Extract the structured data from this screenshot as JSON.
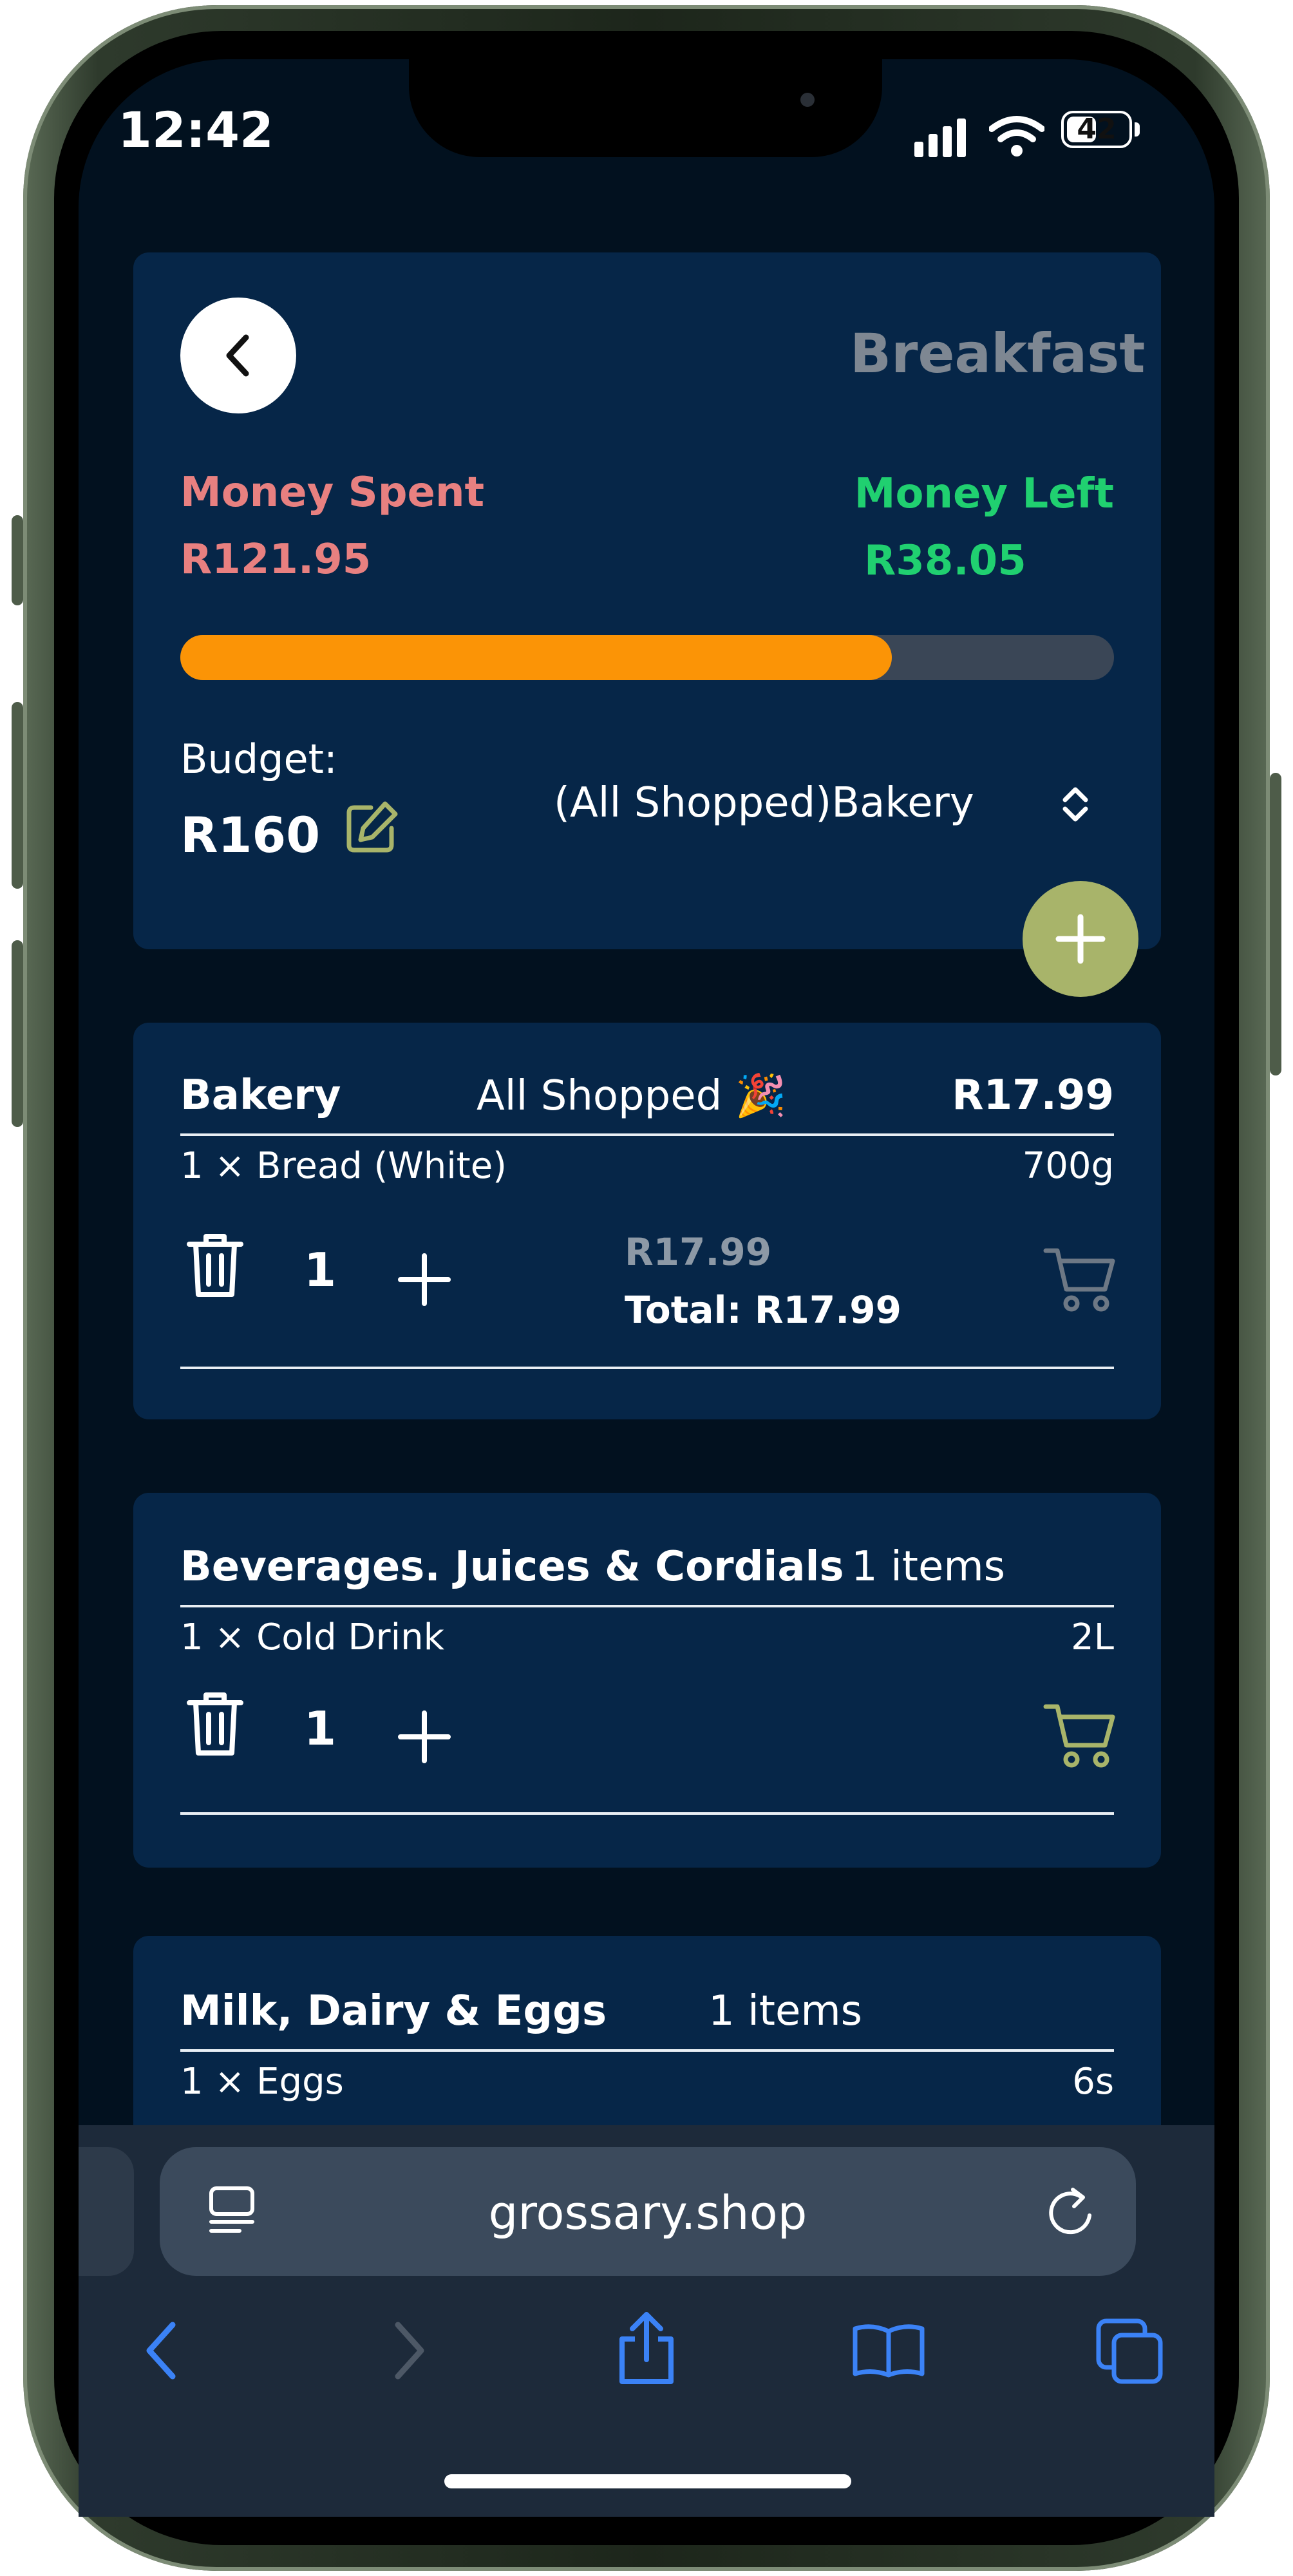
{
  "status": {
    "time": "12:42",
    "battery": "42"
  },
  "header": {
    "title": "Breakfast",
    "money_spent_label": "Money Spent",
    "money_spent_value": "R121.95",
    "money_left_label": "Money Left",
    "money_left_value": "R38.05",
    "spent_fraction": 0.7622,
    "budget_label": "Budget:",
    "budget_value": "R160",
    "category_select_value": "(All Shopped)Bakery"
  },
  "categories": [
    {
      "name": "Bakery",
      "status": "All Shopped 🎉",
      "total": "R17.99",
      "item_line": "1 × Bread (White)",
      "size": "700g",
      "quantity": "1",
      "unit_price": "R17.99",
      "line_total": "Total: R17.99",
      "in_cart": true
    },
    {
      "name": "Beverages. Juices & Cordials",
      "status": "1 items",
      "item_line": "1 × Cold Drink",
      "size": "2L",
      "quantity": "1",
      "in_cart": false
    },
    {
      "name": "Milk, Dairy & Eggs",
      "status": "1 items",
      "item_line": "1 × Eggs",
      "size": "6s"
    }
  ],
  "browser": {
    "url": "grossary.shop"
  },
  "colors": {
    "background": "#02111f",
    "card": "#062648",
    "spent": "#e88080",
    "left": "#20d070",
    "progress": "#fb9406",
    "accent_green": "#a8b46a",
    "browser_blue": "#3b82f6"
  },
  "icons": [
    "back-chevron-icon",
    "edit-icon",
    "select-chevron-icon",
    "plus-icon",
    "trash-icon",
    "cart-icon",
    "reader-icon",
    "reload-icon",
    "share-icon",
    "bookmarks-icon",
    "tabs-icon"
  ]
}
